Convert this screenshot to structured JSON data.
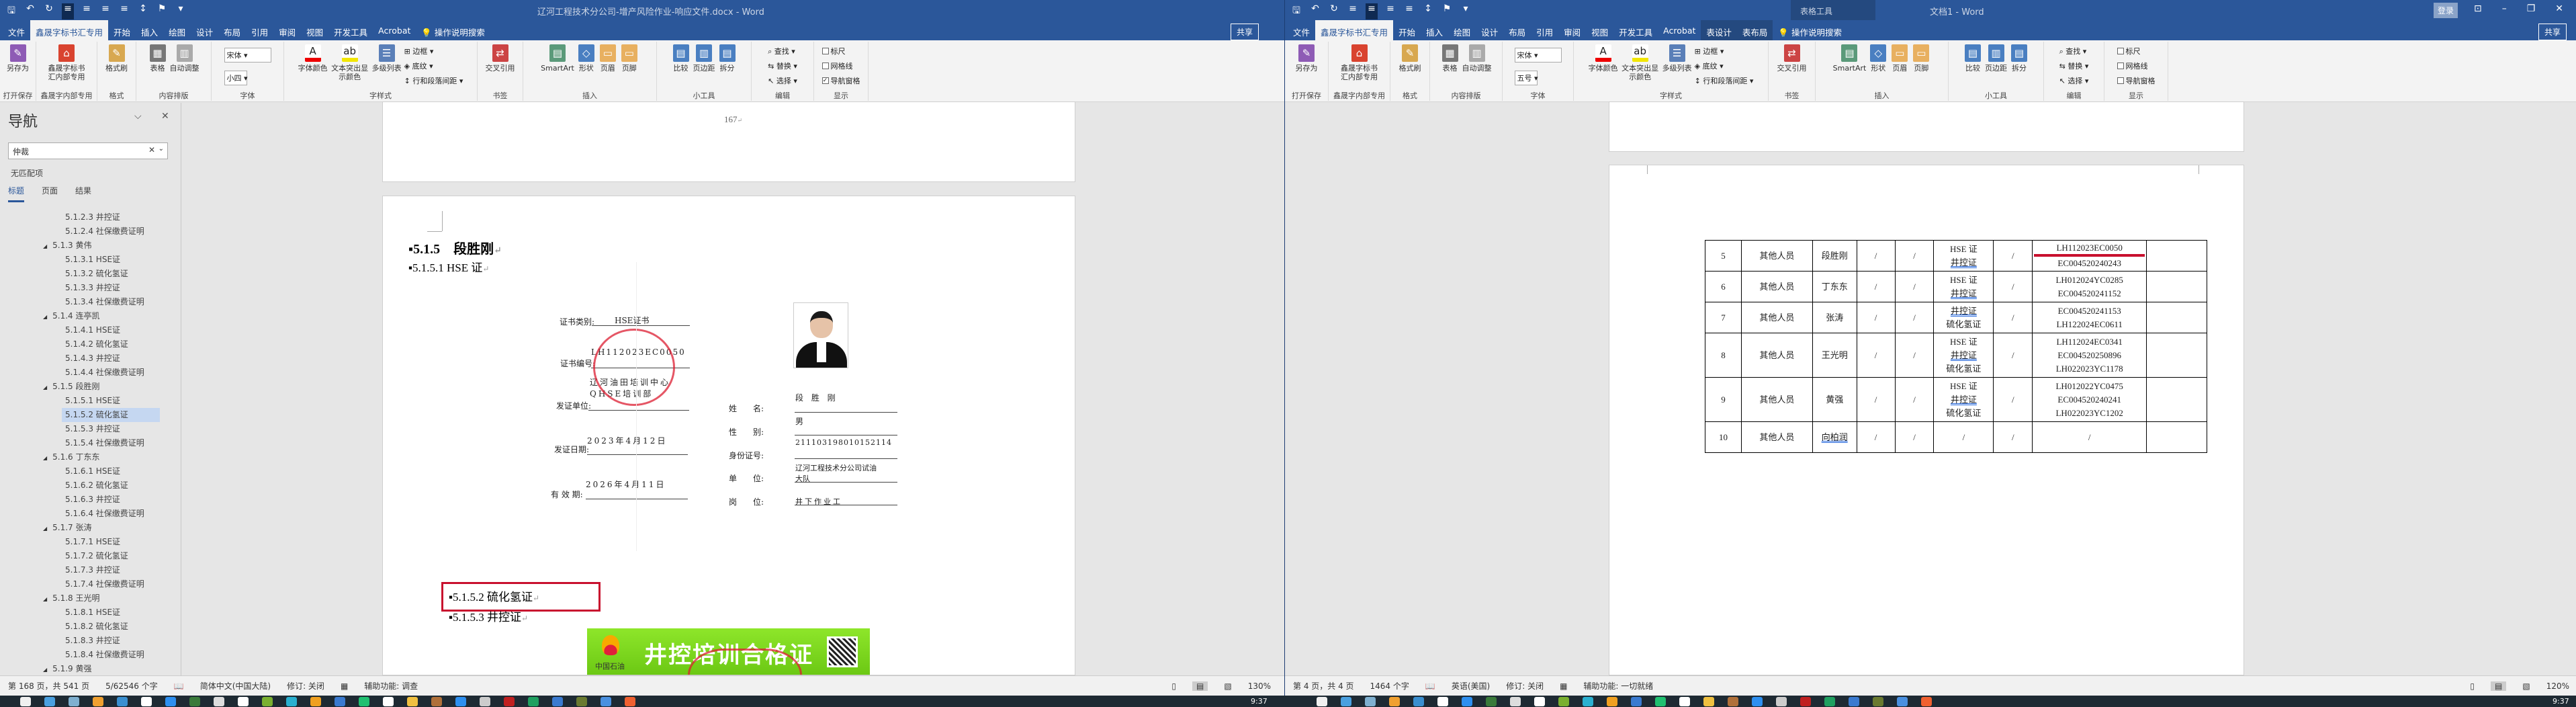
{
  "left_window": {
    "title": "辽河工程技术分公司-增产风险作业-响应文件.docx  -  Word",
    "tabs": [
      "文件",
      "鑫晟字标书汇专用",
      "开始",
      "插入",
      "绘图",
      "设计",
      "布局",
      "引用",
      "审阅",
      "视图",
      "开发工具",
      "Acrobat",
      "操作说明搜索"
    ],
    "share": "共享",
    "font_name": "宋体",
    "font_size": "小四",
    "show_checks": [
      {
        "label": "标尺",
        "checked": false
      },
      {
        "label": "网格线",
        "checked": false
      },
      {
        "label": "导航窗格",
        "checked": true
      }
    ],
    "nav": {
      "title": "导航",
      "search_value": "仲裁",
      "no_match": "无匹配项",
      "tabs": [
        "标题",
        "页面",
        "结果"
      ],
      "items": [
        {
          "level": 3,
          "label": "5.1.2.3 井控证"
        },
        {
          "level": 3,
          "label": "5.1.2.4 社保缴费证明"
        },
        {
          "level": 2,
          "label": "5.1.3 黄伟"
        },
        {
          "level": 3,
          "label": "5.1.3.1 HSE证"
        },
        {
          "level": 3,
          "label": "5.1.3.2 硫化氢证"
        },
        {
          "level": 3,
          "label": "5.1.3.3 井控证"
        },
        {
          "level": 3,
          "label": "5.1.3.4 社保缴费证明"
        },
        {
          "level": 2,
          "label": "5.1.4 连亭凯"
        },
        {
          "level": 3,
          "label": "5.1.4.1 HSE证"
        },
        {
          "level": 3,
          "label": "5.1.4.2 硫化氢证"
        },
        {
          "level": 3,
          "label": "5.1.4.3 井控证"
        },
        {
          "level": 3,
          "label": "5.1.4.4 社保缴费证明"
        },
        {
          "level": 2,
          "label": "5.1.5 段胜刚"
        },
        {
          "level": 3,
          "label": "5.1.5.1 HSE证"
        },
        {
          "level": 3,
          "label": "5.1.5.2 硫化氢证",
          "selected": true
        },
        {
          "level": 3,
          "label": "5.1.5.3 井控证"
        },
        {
          "level": 3,
          "label": "5.1.5.4 社保缴费证明"
        },
        {
          "level": 2,
          "label": "5.1.6 丁东东"
        },
        {
          "level": 3,
          "label": "5.1.6.1 HSE证"
        },
        {
          "level": 3,
          "label": "5.1.6.2 硫化氢证"
        },
        {
          "level": 3,
          "label": "5.1.6.3 井控证"
        },
        {
          "level": 3,
          "label": "5.1.6.4 社保缴费证明"
        },
        {
          "level": 2,
          "label": "5.1.7 张涛"
        },
        {
          "level": 3,
          "label": "5.1.7.1 HSE证"
        },
        {
          "level": 3,
          "label": "5.1.7.2 硫化氢证"
        },
        {
          "level": 3,
          "label": "5.1.7.3 井控证"
        },
        {
          "level": 3,
          "label": "5.1.7.4 社保缴费证明"
        },
        {
          "level": 2,
          "label": "5.1.8 王光明"
        },
        {
          "level": 3,
          "label": "5.1.8.1 HSE证"
        },
        {
          "level": 3,
          "label": "5.1.8.2 硫化氢证"
        },
        {
          "level": 3,
          "label": "5.1.8.3 井控证"
        },
        {
          "level": 3,
          "label": "5.1.8.4 社保缴费证明"
        },
        {
          "level": 2,
          "label": "5.1.9 黄强"
        }
      ]
    },
    "doc": {
      "page_number": "167",
      "h1": "5.1.5　段胜刚",
      "h_hse": "5.1.5.1  HSE 证",
      "h_h2s": "5.1.5.2  硫化氢证",
      "h_jk": "5.1.5.3  井控证",
      "cert": {
        "type_label": "证书类别:",
        "type_value": "HSE证书",
        "no_label": "证书编号:",
        "no_value": "LH112023EC0050",
        "unit_label": "发证单位:",
        "unit_value1": "辽河油田培训中心",
        "unit_value2": "QHSE培训部",
        "date_label": "发证日期:",
        "date_value": "2023年4月12日",
        "valid_label": "有 效 期:",
        "valid_value": "2026年4月11日",
        "name_label": "姓　　名:",
        "name_value": "段 胜 刚",
        "sex_label": "性　　别:",
        "sex_value": "男",
        "id_label": "身份证号:",
        "id_value": "211103198010152114",
        "org_label": "单　　位:",
        "org_value1": "辽河工程技术分公司试油",
        "org_value2": "大队",
        "post_label": "岗　　位:",
        "post_value": "井下作业工"
      },
      "banner": {
        "title": "井控培训合格证",
        "brand": "中国石油"
      }
    },
    "status": {
      "page": "第 168 页，共 541 页",
      "words": "5/62546 个字",
      "language": "简体中文(中国大陆)",
      "track": "修订: 关闭",
      "accessibility": "辅助功能: 调查",
      "zoom": "130%"
    }
  },
  "right_window": {
    "title": "文档1  -  Word",
    "context_title": "表格工具",
    "tabs": [
      "文件",
      "鑫晟字标书汇专用",
      "开始",
      "插入",
      "绘图",
      "设计",
      "布局",
      "引用",
      "审阅",
      "视图",
      "开发工具",
      "Acrobat",
      "表设计",
      "表布局",
      "操作说明搜索"
    ],
    "signin": "登录",
    "share": "共享",
    "font_name": "宋体",
    "font_size": "五号",
    "show_checks": [
      {
        "label": "标尺",
        "checked": false
      },
      {
        "label": "网格线",
        "checked": false
      },
      {
        "label": "导航窗格",
        "checked": false
      }
    ],
    "table": {
      "rows": [
        {
          "no": "5",
          "role": "其他人员",
          "name": "段胜刚",
          "c4": "/",
          "c5": "/",
          "certs": [
            "HSE 证",
            "井控证"
          ],
          "c7": "/",
          "numbers": [
            "LH112023EC0050",
            "EC004520240243"
          ],
          "last": ""
        },
        {
          "no": "6",
          "role": "其他人员",
          "name": "丁东东",
          "c4": "/",
          "c5": "/",
          "certs": [
            "HSE 证",
            "井控证"
          ],
          "c7": "/",
          "numbers": [
            "LH012024YC0285",
            "EC004520241152"
          ],
          "last": ""
        },
        {
          "no": "7",
          "role": "其他人员",
          "name": "张涛",
          "c4": "/",
          "c5": "/",
          "certs": [
            "井控证",
            "硫化氢证"
          ],
          "c7": "/",
          "numbers": [
            "EC004520241153",
            "LH122024EC0611"
          ],
          "last": ""
        },
        {
          "no": "8",
          "role": "其他人员",
          "name": "王光明",
          "c4": "/",
          "c5": "/",
          "certs": [
            "HSE 证",
            "井控证",
            "硫化氢证"
          ],
          "c7": "/",
          "numbers": [
            "LH112024EC0341",
            "EC004520250896",
            "LH022023YC1178"
          ],
          "last": ""
        },
        {
          "no": "9",
          "role": "其他人员",
          "name": "黄强",
          "c4": "/",
          "c5": "/",
          "certs": [
            "HSE 证",
            "井控证",
            "硫化氢证"
          ],
          "c7": "/",
          "numbers": [
            "LH012022YC0475",
            "EC004520240241",
            "LH022023YC1202"
          ],
          "last": ""
        },
        {
          "no": "10",
          "role": "其他人员",
          "name": "向柏润",
          "c4": "/",
          "c5": "/",
          "certs": [
            "/"
          ],
          "c7": "/",
          "numbers": [
            "/"
          ],
          "last": ""
        }
      ]
    },
    "status": {
      "page": "第 4 页，共 4 页",
      "words": "1464 个字",
      "language": "英语(美国)",
      "track": "修订: 关闭",
      "accessibility": "辅助功能: 一切就绪",
      "zoom": "120%"
    }
  },
  "ribbon": {
    "groups": [
      {
        "label": "打开保存",
        "buttons": [
          "另存为"
        ]
      },
      {
        "label": "鑫晟字内部专用",
        "buttons": [
          "鑫晟字标书汇内部专用"
        ]
      },
      {
        "label": "格式",
        "buttons": [
          "格式刷"
        ]
      },
      {
        "label": "内容排版",
        "buttons": [
          "表格",
          "自动调整"
        ]
      },
      {
        "label": "字体",
        "buttons": []
      },
      {
        "label": "字样式",
        "buttons": [
          "字体颜色",
          "文本突出显示颜色",
          "多级列表"
        ],
        "small": [
          "边框",
          "底纹",
          "行和段落间距"
        ]
      },
      {
        "label": "书签",
        "buttons": [
          "交叉引用"
        ]
      },
      {
        "label": "插入",
        "buttons": [
          "SmartArt",
          "形状",
          "页眉",
          "页脚"
        ]
      },
      {
        "label": "小工具",
        "buttons": [
          "比较",
          "页边距",
          "拆分"
        ]
      },
      {
        "label": "编辑",
        "buttons": [],
        "small": [
          "查找",
          "替换",
          "选择"
        ]
      },
      {
        "label": "显示",
        "buttons": []
      }
    ]
  },
  "taskbar": {
    "time": "9:37"
  },
  "colors": {
    "word_blue": "#2b579a",
    "highlight": "#c5d7f1",
    "red_box": "#c8102e",
    "banner_green": "#7fd81e"
  }
}
